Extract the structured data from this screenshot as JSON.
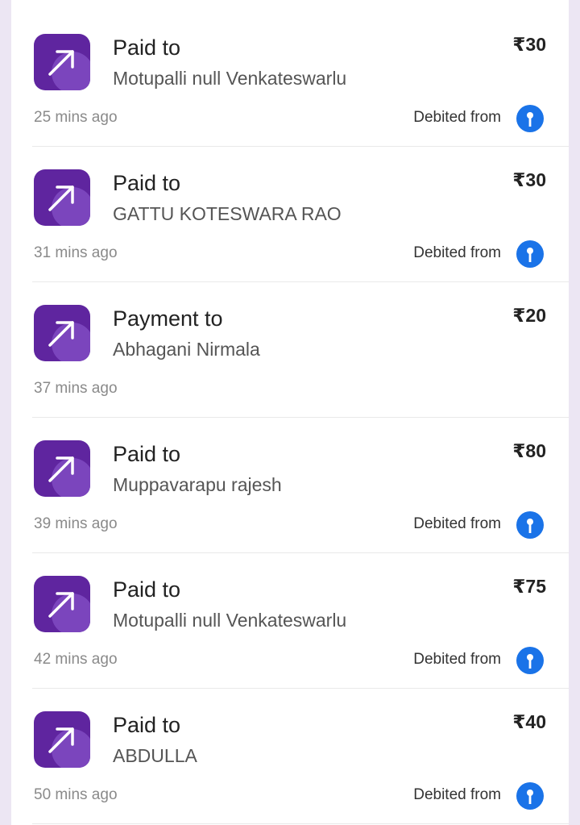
{
  "colors": {
    "brand": "#5f259f",
    "bank": "#1a73e8"
  },
  "transactions": [
    {
      "type": "Paid to",
      "name": "Motupalli null Venkateswarlu",
      "amount": "₹30",
      "time": "25 mins ago",
      "debited": "Debited from",
      "icon": "arrow-up-right-icon",
      "bank_icon": "bank-logo-icon"
    },
    {
      "type": "Paid to",
      "name": "GATTU KOTESWARA RAO",
      "amount": "₹30",
      "time": "31 mins ago",
      "debited": "Debited from",
      "icon": "arrow-up-right-icon",
      "bank_icon": "bank-logo-icon"
    },
    {
      "type": "Payment to",
      "name": "Abhagani Nirmala",
      "amount": "₹20",
      "time": "37 mins ago",
      "debited": "",
      "icon": "arrow-up-right-icon",
      "bank_icon": ""
    },
    {
      "type": "Paid to",
      "name": "Muppavarapu rajesh",
      "amount": "₹80",
      "time": "39 mins ago",
      "debited": "Debited from",
      "icon": "arrow-up-right-icon",
      "bank_icon": "bank-logo-icon"
    },
    {
      "type": "Paid to",
      "name": "Motupalli null Venkateswarlu",
      "amount": "₹75",
      "time": "42 mins ago",
      "debited": "Debited from",
      "icon": "arrow-up-right-icon",
      "bank_icon": "bank-logo-icon"
    },
    {
      "type": "Paid to",
      "name": "ABDULLA",
      "amount": "₹40",
      "time": "50 mins ago",
      "debited": "Debited from",
      "icon": "arrow-up-right-icon",
      "bank_icon": "bank-logo-icon"
    }
  ]
}
